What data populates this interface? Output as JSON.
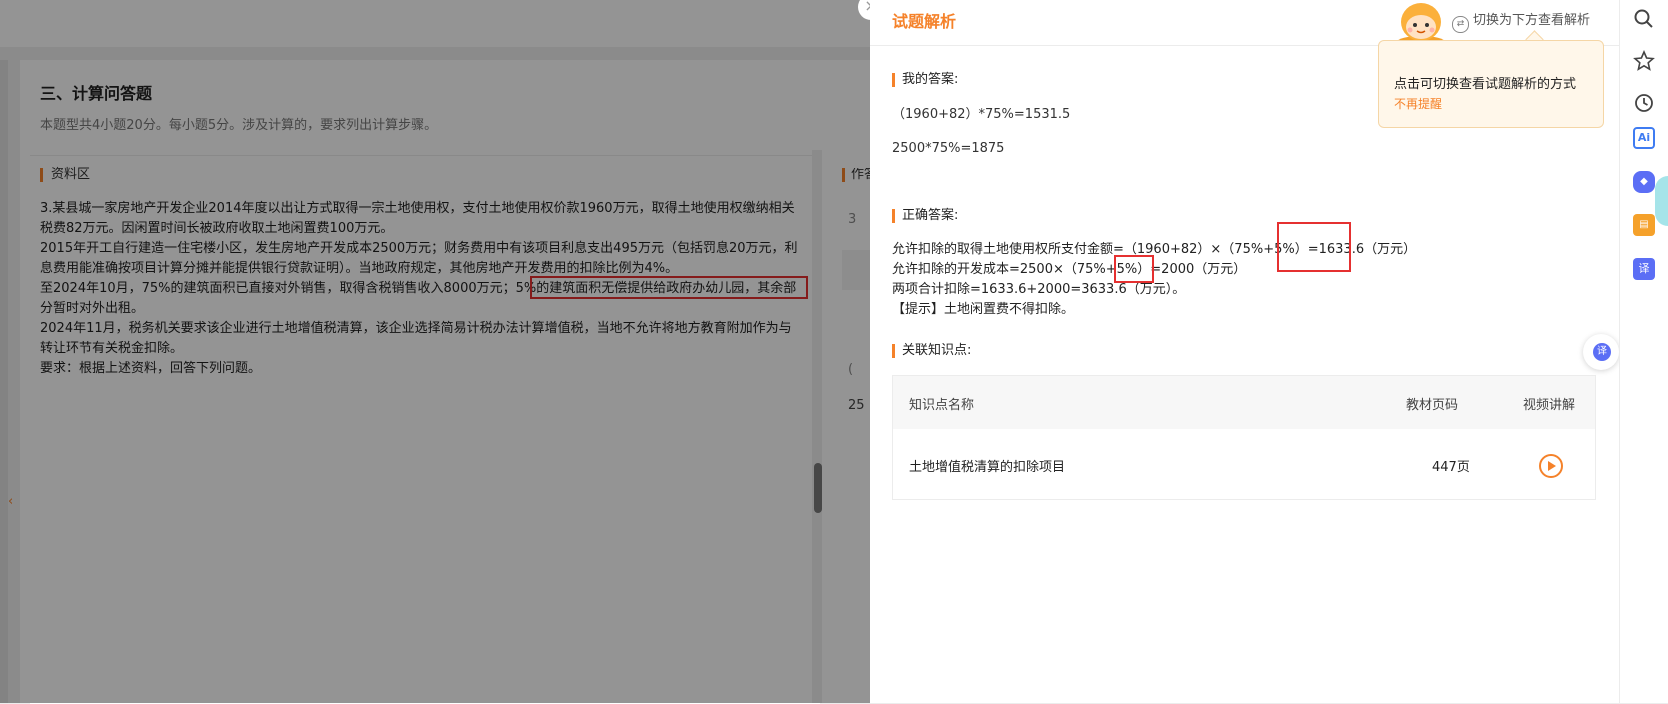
{
  "exam": {
    "section_title": "三、计算问答题",
    "section_desc": "本题型共4小题20分。每小题5分。涉及计算的，要求列出计算步骤。",
    "material_header": "资料区",
    "material_paragraphs": [
      "3.某县城一家房地产开发企业2014年度以出让方式取得一宗土地使用权，支付土地使用权价款1960万元，取得土地使用权缴纳相关税费82万元。因闲置时间长被政府收取土地闲置费100万元。",
      "2015年开工自行建造一住宅楼小区，发生房地产开发成本2500万元；财务费用中有该项目利息支出495万元（包括罚息20万元，利息费用能准确按项目计算分摊并能提供银行贷款证明）。当地政府规定，其他房地产开发费用的扣除比例为4%。",
      "至2024年10月，75%的建筑面积已直接对外销售，取得含税销售收入8000万元；5%的建筑面积无偿提供给政府办幼儿园，其余部分暂时对外出租。",
      "2024年11月，税务机关要求该企业进行土地增值税清算，该企业选择简易计税办法计算增值税，当地不允许将地方教育附加作为与转让环节有关税金扣除。",
      "要求：根据上述资料，回答下列问题。"
    ],
    "peek_header": "作答",
    "peek_a": "3",
    "peek_b": "(",
    "peek_c": "25",
    "collapse_arrow": "‹"
  },
  "drawer": {
    "title": "试题解析",
    "close_icon": "×",
    "switch_label": "切换为下方查看解析",
    "tooltip_text": "点击可切换查看试题解析的方式",
    "tooltip_link": "不再提醒",
    "my_answer_label": "我的答案:",
    "my_answer_lines": [
      "（1960+82）*75%=1531.5",
      "2500*75%=1875"
    ],
    "correct_label": "正确答案:",
    "correct_lines": [
      "允许扣除的取得土地使用权所支付金额=（1960+82）×（75%+5%）=1633.6（万元）",
      "允许扣除的开发成本=2500×（75%+5%）=2000（万元）",
      "两项合计扣除=1633.6+2000=3633.6（万元）。",
      "【提示】土地闲置费不得扣除。"
    ],
    "knowledge_label": "关联知识点:",
    "table": {
      "headers": [
        "知识点名称",
        "教材页码",
        "视频讲解"
      ],
      "rows": [
        {
          "name": "土地增值税清算的扣除项目",
          "page": "447页"
        }
      ]
    },
    "translate_icon": "译"
  },
  "toolbar": {
    "icons": [
      "search-icon",
      "star-icon",
      "clock-icon",
      "ai-icon",
      "game-icon",
      "bag-icon",
      "translate-icon"
    ],
    "ai_label": "Ai",
    "game_label": "◆",
    "bag_label": "▤",
    "translate_label": "译"
  },
  "colors": {
    "accent": "#f5822a",
    "highlight_box": "#e53030",
    "tooltip_bg": "#fff7ea"
  }
}
